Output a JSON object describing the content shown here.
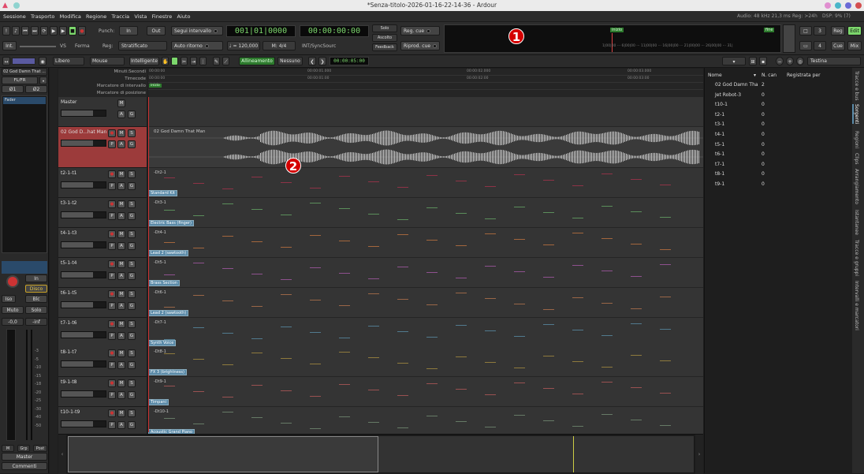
{
  "window": {
    "title": "*Senza-titolo-2026-01-16-22-14-36 - Ardour"
  },
  "menu": [
    "Sessione",
    "Trasporto",
    "Modifica",
    "Regione",
    "Traccia",
    "Vista",
    "Finestre",
    "Aiuto"
  ],
  "status": {
    "audio": "Audio: 48 kHz 21,3 ms",
    "rec": "Reg: >24h",
    "dsp": "DSP: 9% (7)"
  },
  "transport": {
    "punch_label": "Punch:",
    "punch_in": "In",
    "punch_out": "Out",
    "int": "Int.",
    "vs": "VS",
    "stop": "Ferma",
    "reg_label": "Reg:",
    "reg_mode": "Stratificato",
    "follow": "Segui intervallo",
    "auto_return": "Auto ritorno",
    "bbt": "001|01|0000",
    "timecode": "00:00:00:00",
    "tempo": "♩ = 120,000",
    "meter": "M: 4/4",
    "sync": "INT/SyncSourc",
    "solo": "Solo",
    "ascolto": "Ascolto",
    "feedback": "Feedback",
    "reg_cue": "Reg. cue",
    "riprod_cue": "Riprod. cue",
    "mini_start": "inizio",
    "mini_end": "fine",
    "mini_ruler": "1|00|00 ··· 6|00|00 ··· 11|00|00 ··· 16|00|00 ··· 21|00|00 ··· 26|00|00 ··· 31|",
    "right_btns": [
      "Reg",
      "Edit",
      "Cue",
      "Mix"
    ],
    "right_nums": [
      "3",
      "4"
    ]
  },
  "editbar": {
    "mode": "Libero",
    "mouse": "Mouse",
    "smart": "Intelligente",
    "snap": "Allineamento",
    "none": "Nessuno",
    "nudge": "00:00:05:00",
    "zoom": "Testina"
  },
  "rulers": {
    "labels": [
      "Minuti:Secondi",
      "Timecode",
      "Marcatore di intervallo",
      "Marcatore di posizione"
    ],
    "ticks": [
      "00:00:01.000",
      "00:00:02.000",
      "00:00:03.000"
    ],
    "tc_ticks": [
      "00:00:01:00",
      "00:00:02:00",
      "00:00:03:00"
    ],
    "start": "00:00:00",
    "inizio": "inizio"
  },
  "strip": {
    "name": "02 God Damn That ...",
    "input": "FL/FR",
    "fader_tab": "Fader",
    "phase": [
      "Ø1",
      "Ø2"
    ],
    "in": "In",
    "disk": "Disco",
    "iso": "Iso",
    "blc": "Blc",
    "mute": "Muto",
    "solo": "Solo",
    "gain": "-0,0",
    "peak": "-inf",
    "btm": [
      "M",
      "Grp",
      "Post"
    ],
    "master": "Master",
    "comments": "Commenti",
    "meter_scale": [
      "-3",
      "-5",
      "-10",
      "-15",
      "-18",
      "-20",
      "-25",
      "-30",
      "-40",
      "-50"
    ]
  },
  "tracks": [
    {
      "name": "Master",
      "region": "",
      "plugin": ""
    },
    {
      "name": "02 God D...hat Man",
      "region": "02 God Damn That Man",
      "plugin": ""
    },
    {
      "name": "t2-1-t1",
      "region": "-Dt2-1",
      "plugin": "Standard Kit"
    },
    {
      "name": "t3-1-t2",
      "region": "-Dt3-1",
      "plugin": "Electric Bass (finger)"
    },
    {
      "name": "t4-1-t3",
      "region": "-Dt4-1",
      "plugin": "Lead 2 (sawtooth)"
    },
    {
      "name": "t5-1-t4",
      "region": "-Dt5-1",
      "plugin": "Brass Section"
    },
    {
      "name": "t6-1-t5",
      "region": "-Dt6-1",
      "plugin": "Lead 2 (sawtooth)"
    },
    {
      "name": "t7-1-t6",
      "region": "-Dt7-1",
      "plugin": "Synth Voice"
    },
    {
      "name": "t8-1-t7",
      "region": "-Dt8-1",
      "plugin": "FX 3 (brightness)"
    },
    {
      "name": "t9-1-t8",
      "region": "-Dt9-1",
      "plugin": "Timpani"
    },
    {
      "name": "t10-1-t9",
      "region": "-Dt10-1",
      "plugin": "Acoustic Grand Piano"
    }
  ],
  "track_btns": {
    "m": "M",
    "s": "S",
    "p": "P",
    "a": "A",
    "g": "G"
  },
  "regions_list": {
    "headers": [
      "Nome",
      "N. can",
      "Registrata per"
    ],
    "rows": [
      [
        "02 God Damn Tha",
        "2"
      ],
      [
        "Jet Robot-3",
        "0"
      ],
      [
        "t10-1",
        "0"
      ],
      [
        "t2-1",
        "0"
      ],
      [
        "t3-1",
        "0"
      ],
      [
        "t4-1",
        "0"
      ],
      [
        "t5-1",
        "0"
      ],
      [
        "t6-1",
        "0"
      ],
      [
        "t7-1",
        "0"
      ],
      [
        "t8-1",
        "0"
      ],
      [
        "t9-1",
        "0"
      ]
    ]
  },
  "side_tabs": [
    "Tracce e bus",
    "Sorgenti",
    "Regioni",
    "Clips",
    "Arrangiamento",
    "Istantanee",
    "Tracce e gruppi",
    "Intervalli e marcatori"
  ],
  "markers": [
    "1",
    "2"
  ],
  "colors": {
    "accent": "#7cd76c",
    "selected_track": "#9c3b3b",
    "marker": "#d40000",
    "plugin_label": "#5a8aa8"
  }
}
